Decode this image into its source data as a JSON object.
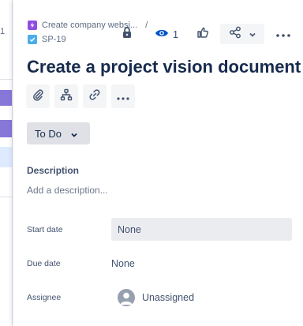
{
  "background": {
    "row_number": "1"
  },
  "breadcrumb": {
    "epic_label": "Create company websi...",
    "separator": "/",
    "issue_key": "SP-19"
  },
  "header": {
    "watch_count": "1"
  },
  "issue": {
    "title": "Create a project vision document"
  },
  "status": {
    "label": "To Do"
  },
  "description": {
    "heading": "Description",
    "placeholder": "Add a description..."
  },
  "fields": {
    "start_date": {
      "label": "Start date",
      "value": "None"
    },
    "due_date": {
      "label": "Due date",
      "value": "None"
    },
    "assignee": {
      "label": "Assignee",
      "value": "Unassigned"
    }
  },
  "colors": {
    "epic": "#904ee2",
    "task": "#4bade8",
    "board_bar": "#8777d9",
    "text": "#172b4d"
  },
  "icons": [
    "lock-icon",
    "eye-icon",
    "thumbs-up-icon",
    "share-icon",
    "chevron-down-icon",
    "more-icon",
    "attachment-icon",
    "child-issue-icon",
    "link-icon",
    "avatar-icon"
  ]
}
